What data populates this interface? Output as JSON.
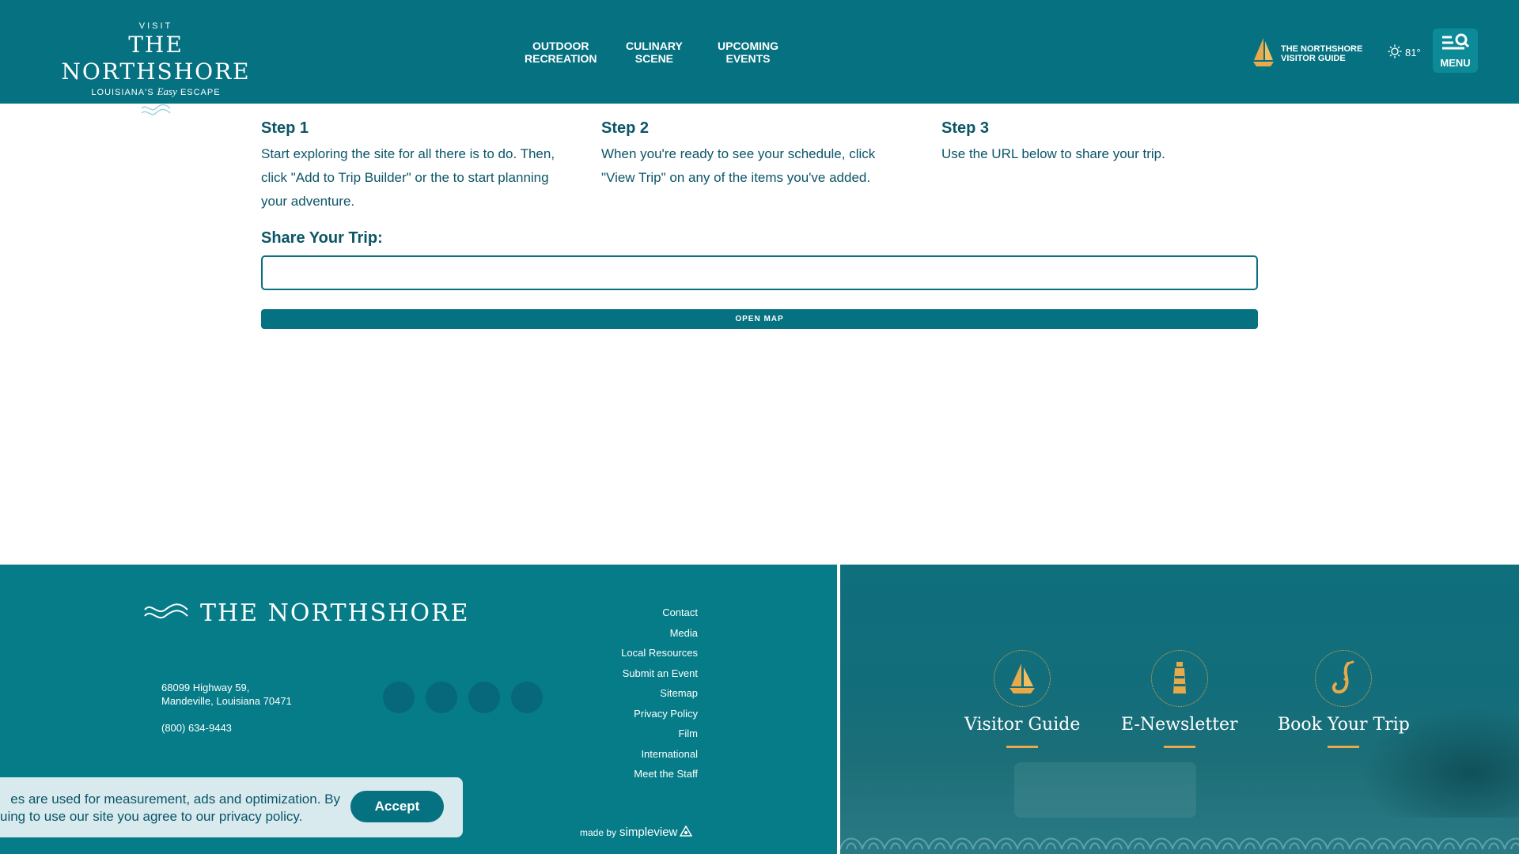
{
  "header": {
    "logo": {
      "visit": "VISIT",
      "name": "THE NORTHSHORE",
      "tagline_pre": "LOUISIANA'S",
      "tagline_easy": "Easy",
      "tagline_post": "ESCAPE"
    },
    "nav": [
      {
        "label": "OUTDOOR\nRECREATION"
      },
      {
        "label": "CULINARY\nSCENE"
      },
      {
        "label": "UPCOMING\nEVENTS"
      }
    ],
    "visitor_guide": "THE NORTHSHORE\nVISITOR GUIDE",
    "weather": "81°",
    "menu_label": "MENU"
  },
  "steps": [
    {
      "title": "Step 1",
      "text": "Start exploring the site for all there is to do. Then, click \"Add to Trip Builder\" or the   to start planning your adventure."
    },
    {
      "title": "Step 2",
      "text": "When you're ready to see your schedule, click \"View Trip\" on any of the items you've added."
    },
    {
      "title": "Step 3",
      "text": "Use the URL below to share your trip."
    }
  ],
  "share": {
    "label": "Share Your Trip:",
    "value": "",
    "button": "OPEN MAP"
  },
  "footer": {
    "logo_name": "THE NORTHSHORE",
    "address_line1": "68099 Highway 59,",
    "address_line2": "Mandeville, Louisiana 70471",
    "phone": "(800) 634-9443",
    "links": [
      "Contact",
      "Media",
      "Local Resources",
      "Submit an Event",
      "Sitemap",
      "Privacy Policy",
      "Film",
      "International",
      "Meet the Staff"
    ],
    "made_by": "made by",
    "made_by_brand": "simpleview",
    "ctas": [
      {
        "label": "Visitor Guide",
        "icon": "sailboat-icon"
      },
      {
        "label": "E-Newsletter",
        "icon": "lighthouse-icon"
      },
      {
        "label": "Book Your Trip",
        "icon": "saxophone-icon"
      }
    ]
  },
  "cookie": {
    "line1": "es are used for measurement, ads and optimization. By",
    "line2": "uing to use our site you agree to our privacy policy.",
    "accept": "Accept"
  },
  "colors": {
    "brand_teal": "#067281",
    "footer_teal": "#057c88",
    "accent_gold": "#e8a94a",
    "text_dark_teal": "#0b5567"
  }
}
